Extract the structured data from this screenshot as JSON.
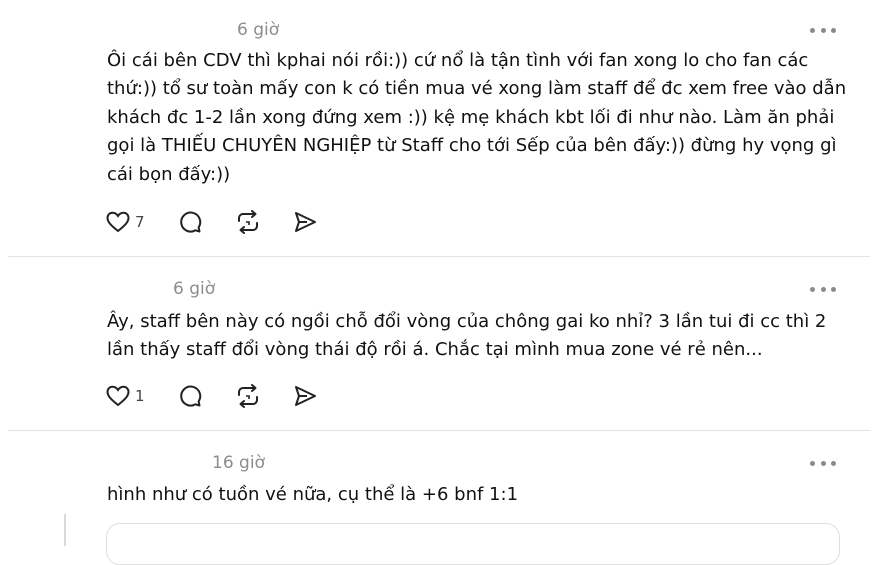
{
  "posts": [
    {
      "time": "6 giờ",
      "text": "Ôi cái bên CDV thì kphai nói rồi:)) cứ nổ là tận tình với fan xong lo cho fan các thứ:)) tổ sư toàn mấy con k có tiền mua vé xong làm staff để đc xem free vào dẫn khách đc 1-2 lần xong đứng xem :)) kệ mẹ khách kbt lối đi như nào. Làm ăn phải gọi là THIẾU CHUYÊN NGHIỆP từ Staff cho tới Sếp của bên đấy:)) đừng hy vọng gì cái bọn đấy:))",
      "likes": "7"
    },
    {
      "time": "6 giờ",
      "text": "Ây, staff bên này có ngồi chỗ đổi vòng của chông gai ko nhỉ? 3 lần tui đi cc thì 2 lần thấy staff đổi vòng thái độ rồi á. Chắc tại mình mua zone vé rẻ nên...",
      "likes": "1"
    },
    {
      "time": "16 giờ",
      "text": "hình như có tuồn vé nữa, cụ thể là +6 bnf 1:1"
    }
  ],
  "icons": [
    "more-icon",
    "heart-icon",
    "comment-icon",
    "repost-icon",
    "share-icon"
  ]
}
